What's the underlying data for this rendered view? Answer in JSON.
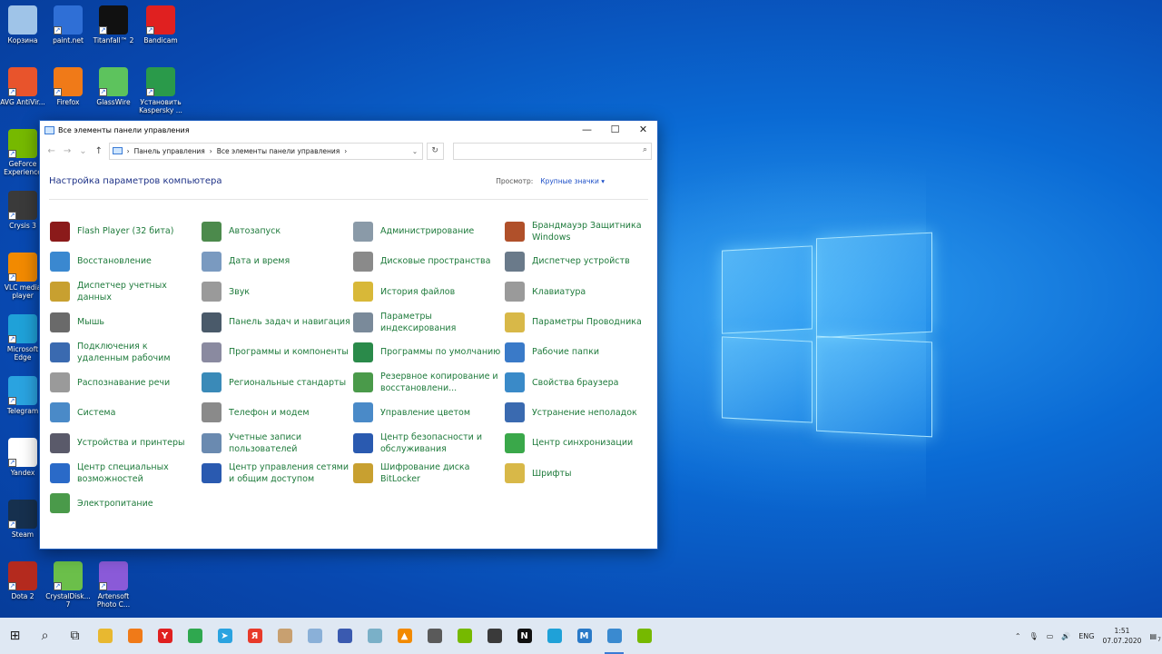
{
  "desktop": {
    "icons": [
      {
        "label": "Корзина",
        "icon": "recycle-bin-icon",
        "color": "#9fc4e8"
      },
      {
        "label": "paint.net",
        "icon": "paintnet-icon",
        "color": "#2f6fd6"
      },
      {
        "label": "Titanfall™ 2",
        "icon": "titanfall-icon",
        "color": "#111111"
      },
      {
        "label": "Bandicam",
        "icon": "bandicam-icon",
        "color": "#e02020"
      },
      {
        "label": "AVG AntiVir...",
        "icon": "avg-icon",
        "color": "#e8542c"
      },
      {
        "label": "Firefox",
        "icon": "firefox-icon",
        "color": "#f07a18"
      },
      {
        "label": "GlassWire",
        "icon": "glasswire-icon",
        "color": "#5dc35d"
      },
      {
        "label": "Установить Kaspersky ...",
        "icon": "kaspersky-icon",
        "color": "#2a9a4a"
      },
      {
        "label": "GeForce Experience",
        "icon": "geforce-icon",
        "color": "#76b900"
      },
      {
        "label": "Crysis 3",
        "icon": "crysis-icon",
        "color": "#3a3a3a"
      },
      {
        "label": "VLC media player",
        "icon": "vlc-icon",
        "color": "#f28a00"
      },
      {
        "label": "Microsoft Edge",
        "icon": "edge-icon",
        "color": "#1fa1d8"
      },
      {
        "label": "Telegram",
        "icon": "telegram-icon",
        "color": "#2aa3e0"
      },
      {
        "label": "Yandex",
        "icon": "yandex-icon",
        "color": "#ffffff"
      },
      {
        "label": "Steam",
        "icon": "steam-icon",
        "color": "#16304e"
      },
      {
        "label": "Dota 2",
        "icon": "dota-icon",
        "color": "#b42a1e"
      },
      {
        "label": "CrystalDisk... 7",
        "icon": "crystaldisk-icon",
        "color": "#6bbf4a"
      },
      {
        "label": "Artensoft Photo C...",
        "icon": "artensoft-icon",
        "color": "#8a5ad8"
      }
    ]
  },
  "window": {
    "title": "Все элементы панели управления",
    "controls": {
      "minimize": "—",
      "maximize": "☐",
      "close": "✕"
    },
    "nav": {
      "back": "←",
      "forward": "→",
      "recent": "⌄",
      "up": "↑"
    },
    "breadcrumb": {
      "root": "Панель управления",
      "current": "Все элементы панели управления",
      "sep": "›"
    },
    "refresh": "↻",
    "search_placeholder": "",
    "heading": "Настройка параметров компьютера",
    "view_label": "Просмотр:",
    "view_value": "Крупные значки ▾",
    "items": [
      {
        "label": "Flash Player (32 бита)",
        "icon": "flash-player-icon",
        "color": "#8b1a1a"
      },
      {
        "label": "Автозапуск",
        "icon": "autoplay-icon",
        "color": "#4c8a4c"
      },
      {
        "label": "Администрирование",
        "icon": "admin-tools-icon",
        "color": "#8a9aa8"
      },
      {
        "label": "Брандмауэр Защитника Windows",
        "icon": "firewall-icon",
        "color": "#b0502a"
      },
      {
        "label": "Восстановление",
        "icon": "recovery-icon",
        "color": "#3a88d0"
      },
      {
        "label": "Дата и время",
        "icon": "datetime-icon",
        "color": "#7a9ac0"
      },
      {
        "label": "Дисковые пространства",
        "icon": "storage-spaces-icon",
        "color": "#8a8a8a"
      },
      {
        "label": "Диспетчер устройств",
        "icon": "device-manager-icon",
        "color": "#6a7a8a"
      },
      {
        "label": "Диспетчер учетных данных",
        "icon": "credential-manager-icon",
        "color": "#c8a030"
      },
      {
        "label": "Звук",
        "icon": "sound-icon",
        "color": "#9a9a9a"
      },
      {
        "label": "История файлов",
        "icon": "file-history-icon",
        "color": "#d8b838"
      },
      {
        "label": "Клавиатура",
        "icon": "keyboard-icon",
        "color": "#9a9a9a"
      },
      {
        "label": "Мышь",
        "icon": "mouse-icon",
        "color": "#6a6a6a"
      },
      {
        "label": "Панель задач и навигация",
        "icon": "taskbar-icon",
        "color": "#4a5a6a"
      },
      {
        "label": "Параметры индексирования",
        "icon": "indexing-icon",
        "color": "#7a8a9a"
      },
      {
        "label": "Параметры Проводника",
        "icon": "explorer-options-icon",
        "color": "#d8b848"
      },
      {
        "label": "Подключения к удаленным рабочим",
        "icon": "remote-desktop-icon",
        "color": "#3a6ab0"
      },
      {
        "label": "Программы и компоненты",
        "icon": "programs-icon",
        "color": "#8a8aa0"
      },
      {
        "label": "Программы по умолчанию",
        "icon": "default-programs-icon",
        "color": "#2a8a4a"
      },
      {
        "label": "Рабочие папки",
        "icon": "work-folders-icon",
        "color": "#3a7ac8"
      },
      {
        "label": "Распознавание речи",
        "icon": "speech-icon",
        "color": "#9a9a9a"
      },
      {
        "label": "Региональные стандарты",
        "icon": "region-icon",
        "color": "#3a8ab8"
      },
      {
        "label": "Резервное копирование и восстановлени...",
        "icon": "backup-icon",
        "color": "#4a9a4a"
      },
      {
        "label": "Свойства браузера",
        "icon": "internet-options-icon",
        "color": "#3a8ac8"
      },
      {
        "label": "Система",
        "icon": "system-icon",
        "color": "#4a8ac8"
      },
      {
        "label": "Телефон и модем",
        "icon": "phone-modem-icon",
        "color": "#8a8a8a"
      },
      {
        "label": "Управление цветом",
        "icon": "color-management-icon",
        "color": "#4a8ac8"
      },
      {
        "label": "Устранение неполадок",
        "icon": "troubleshoot-icon",
        "color": "#3a6ab0"
      },
      {
        "label": "Устройства и принтеры",
        "icon": "devices-printers-icon",
        "color": "#5a5a6a"
      },
      {
        "label": "Учетные записи пользователей",
        "icon": "user-accounts-icon",
        "color": "#6a8ab0"
      },
      {
        "label": "Центр безопасности и обслуживания",
        "icon": "security-center-icon",
        "color": "#2a5ab0"
      },
      {
        "label": "Центр синхронизации",
        "icon": "sync-center-icon",
        "color": "#3aa84a"
      },
      {
        "label": "Центр специальных возможностей",
        "icon": "ease-of-access-icon",
        "color": "#2a6ac8"
      },
      {
        "label": "Центр управления сетями и общим доступом",
        "icon": "network-center-icon",
        "color": "#2a5ab0"
      },
      {
        "label": "Шифрование диска BitLocker",
        "icon": "bitlocker-icon",
        "color": "#c8a030"
      },
      {
        "label": "Шрифты",
        "icon": "fonts-icon",
        "color": "#d8b848"
      },
      {
        "label": "Электропитание",
        "icon": "power-options-icon",
        "color": "#4a9a4a"
      }
    ]
  },
  "taskbar": {
    "apps": [
      {
        "icon": "start-icon",
        "glyph": "⊞",
        "color": "#1e1e1e"
      },
      {
        "icon": "search-icon",
        "glyph": "⌕",
        "color": "#1e1e1e"
      },
      {
        "icon": "task-view-icon",
        "glyph": "⧉",
        "color": "#1e1e1e"
      },
      {
        "icon": "file-explorer-icon",
        "glyph": "",
        "color": "#e8b830"
      },
      {
        "icon": "firefox-icon",
        "glyph": "",
        "color": "#f07a18"
      },
      {
        "icon": "yandex-icon",
        "glyph": "Y",
        "color": "#e02020"
      },
      {
        "icon": "chrome-icon",
        "glyph": "",
        "color": "#2fa84f"
      },
      {
        "icon": "telegram-icon",
        "glyph": "➤",
        "color": "#2aa3e0"
      },
      {
        "icon": "yandex-browser-icon",
        "glyph": "Я",
        "color": "#e83a2a"
      },
      {
        "icon": "app-icon",
        "glyph": "",
        "color": "#c8a070"
      },
      {
        "icon": "edit-icon",
        "glyph": "",
        "color": "#8ab0d8"
      },
      {
        "icon": "notepad-icon",
        "glyph": "",
        "color": "#3a5ab0"
      },
      {
        "icon": "tool-icon",
        "glyph": "",
        "color": "#7ab0c8"
      },
      {
        "icon": "vlc-icon",
        "glyph": "▲",
        "color": "#f28a00"
      },
      {
        "icon": "calculator-icon",
        "glyph": "",
        "color": "#5a5a5a"
      },
      {
        "icon": "geforce-icon",
        "glyph": "",
        "color": "#76b900"
      },
      {
        "icon": "camera-icon",
        "glyph": "",
        "color": "#3a3a3a"
      },
      {
        "icon": "netflix-icon",
        "glyph": "N",
        "color": "#111111"
      },
      {
        "icon": "edge-icon",
        "glyph": "",
        "color": "#1fa1d8"
      },
      {
        "icon": "mail-icon",
        "glyph": "M",
        "color": "#2a7ac8"
      },
      {
        "icon": "control-panel-icon",
        "glyph": "",
        "color": "#3a8ad0",
        "active": true
      },
      {
        "icon": "nvidia-icon",
        "glyph": "",
        "color": "#76b900"
      }
    ],
    "tray": {
      "chevron": "⌃",
      "lang": "ENG",
      "time": "1:51",
      "date": "07.07.2020",
      "notifications": "7"
    }
  }
}
